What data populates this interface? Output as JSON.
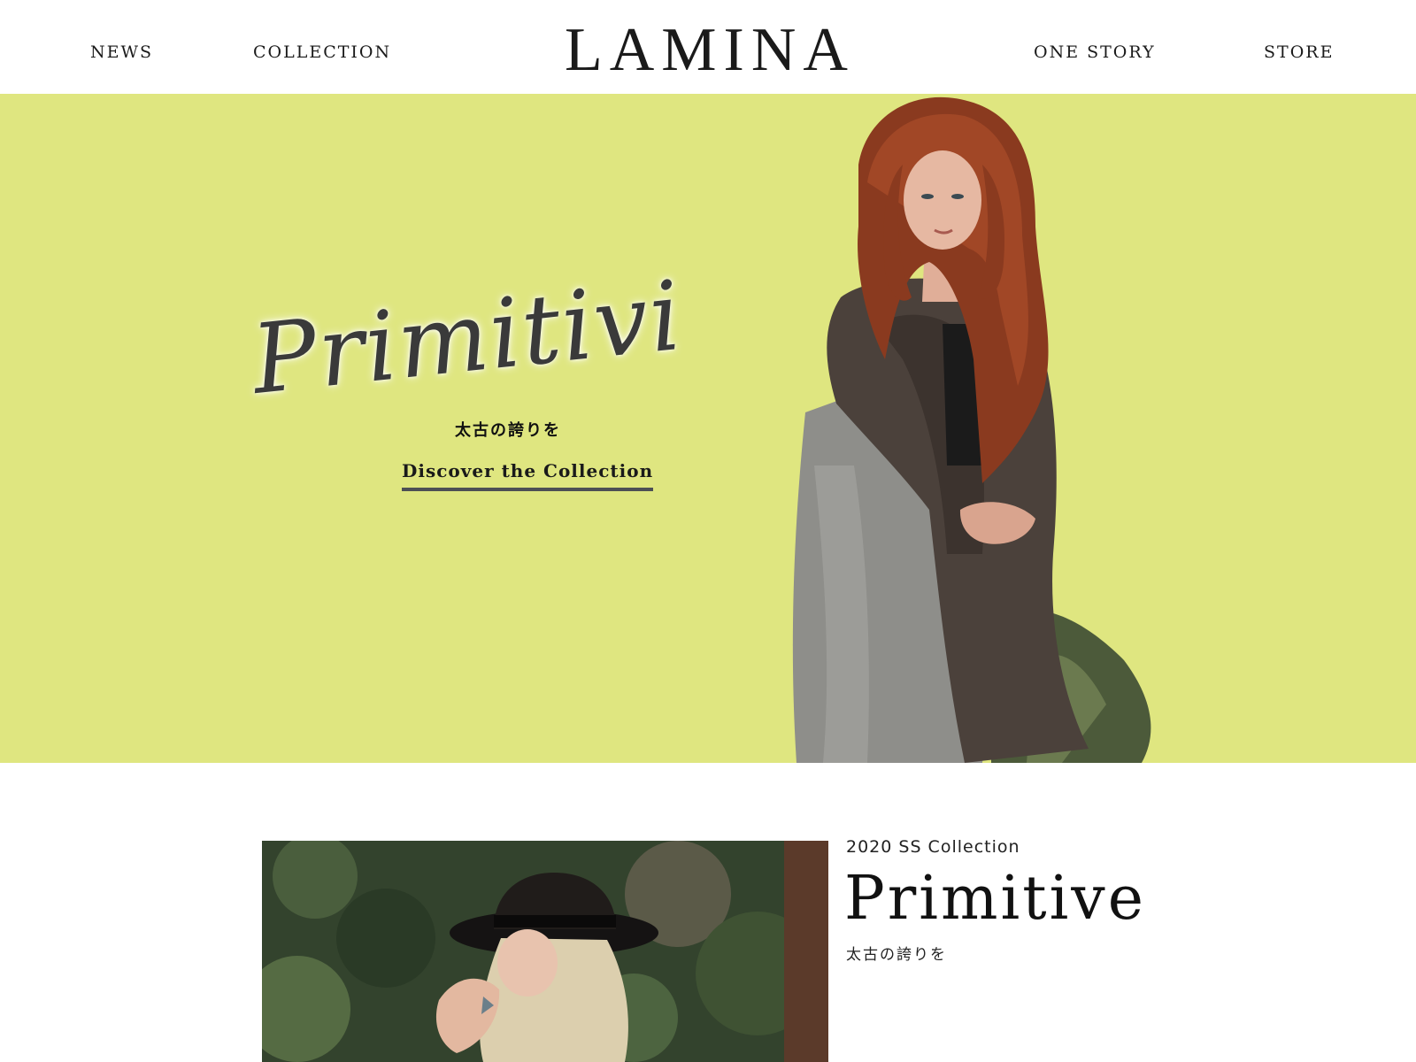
{
  "header": {
    "logo": "LAMINA",
    "nav": {
      "news": "NEWS",
      "collection": "COLLECTION",
      "one_story": "ONE STORY",
      "store": "STORE"
    }
  },
  "hero": {
    "script_title": "Primitivi",
    "tagline": "太古の誇りを",
    "cta_label": "Discover the Collection",
    "background_color": "#dfe680"
  },
  "collection": {
    "season": "2020 SS Collection",
    "title": "Primitive",
    "subtitle": "太古の誇りを"
  }
}
